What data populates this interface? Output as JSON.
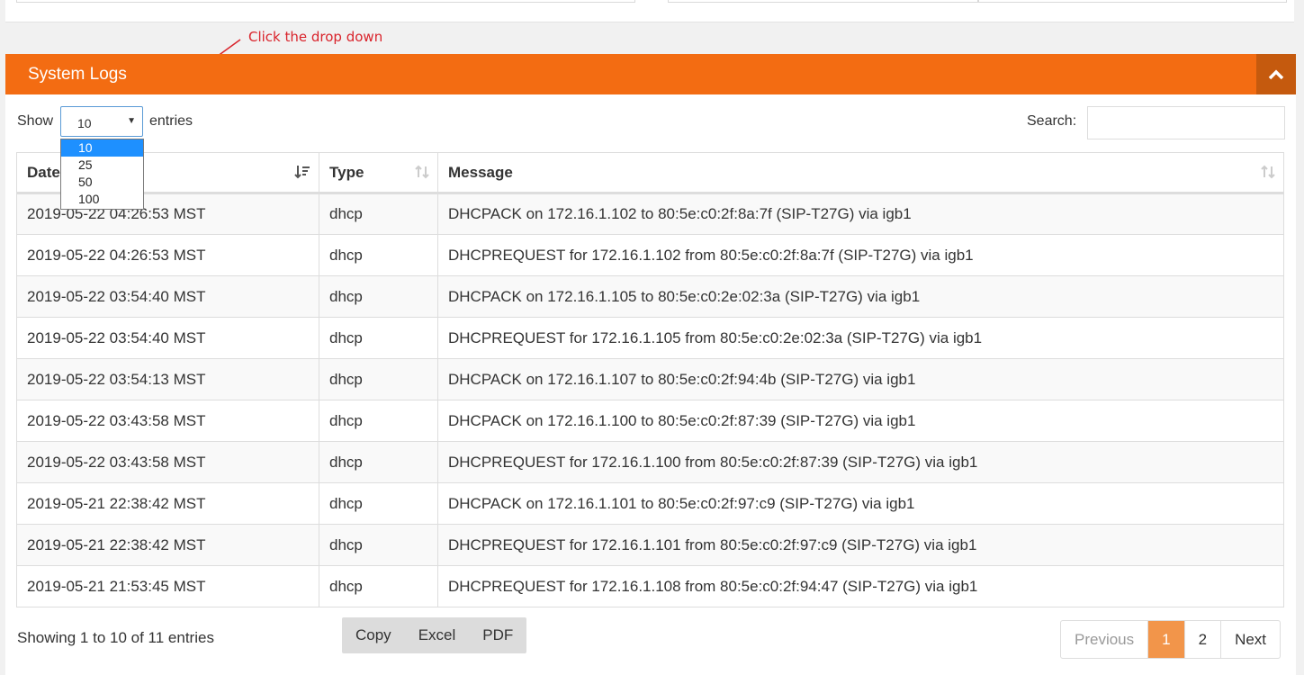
{
  "annotation": "Click the drop down",
  "panel": {
    "title": "System Logs"
  },
  "length": {
    "show_label": "Show",
    "entries_label": "entries",
    "selected": "10",
    "options": [
      "10",
      "25",
      "50",
      "100"
    ]
  },
  "search": {
    "label": "Search:",
    "value": ""
  },
  "columns": [
    "Date",
    "Type",
    "Message"
  ],
  "rows": [
    {
      "date": "2019-05-22 04:26:53 MST",
      "type": "dhcp",
      "message": "DHCPACK on 172.16.1.102 to 80:5e:c0:2f:8a:7f (SIP-T27G) via igb1"
    },
    {
      "date": "2019-05-22 04:26:53 MST",
      "type": "dhcp",
      "message": "DHCPREQUEST for 172.16.1.102 from 80:5e:c0:2f:8a:7f (SIP-T27G) via igb1"
    },
    {
      "date": "2019-05-22 03:54:40 MST",
      "type": "dhcp",
      "message": "DHCPACK on 172.16.1.105 to 80:5e:c0:2e:02:3a (SIP-T27G) via igb1"
    },
    {
      "date": "2019-05-22 03:54:40 MST",
      "type": "dhcp",
      "message": "DHCPREQUEST for 172.16.1.105 from 80:5e:c0:2e:02:3a (SIP-T27G) via igb1"
    },
    {
      "date": "2019-05-22 03:54:13 MST",
      "type": "dhcp",
      "message": "DHCPACK on 172.16.1.107 to 80:5e:c0:2f:94:4b (SIP-T27G) via igb1"
    },
    {
      "date": "2019-05-22 03:43:58 MST",
      "type": "dhcp",
      "message": "DHCPACK on 172.16.1.100 to 80:5e:c0:2f:87:39 (SIP-T27G) via igb1"
    },
    {
      "date": "2019-05-22 03:43:58 MST",
      "type": "dhcp",
      "message": "DHCPREQUEST for 172.16.1.100 from 80:5e:c0:2f:87:39 (SIP-T27G) via igb1"
    },
    {
      "date": "2019-05-21 22:38:42 MST",
      "type": "dhcp",
      "message": "DHCPACK on 172.16.1.101 to 80:5e:c0:2f:97:c9 (SIP-T27G) via igb1"
    },
    {
      "date": "2019-05-21 22:38:42 MST",
      "type": "dhcp",
      "message": "DHCPREQUEST for 172.16.1.101 from 80:5e:c0:2f:97:c9 (SIP-T27G) via igb1"
    },
    {
      "date": "2019-05-21 21:53:45 MST",
      "type": "dhcp",
      "message": "DHCPREQUEST for 172.16.1.108 from 80:5e:c0:2f:94:47 (SIP-T27G) via igb1"
    }
  ],
  "info": "Showing 1 to 10 of 11 entries",
  "export_buttons": [
    "Copy",
    "Excel",
    "PDF"
  ],
  "pagination": {
    "previous": "Previous",
    "pages": [
      "1",
      "2"
    ],
    "active": "1",
    "next": "Next"
  },
  "colors": {
    "accent": "#f36c12",
    "accent_dark": "#c55a0e",
    "active_page": "#f2954a",
    "annotation": "#d9232b"
  },
  "icons": {
    "collapse": "chevron-up-icon",
    "sort_active": "sort-desc-icon",
    "sort": "sort-icon"
  }
}
